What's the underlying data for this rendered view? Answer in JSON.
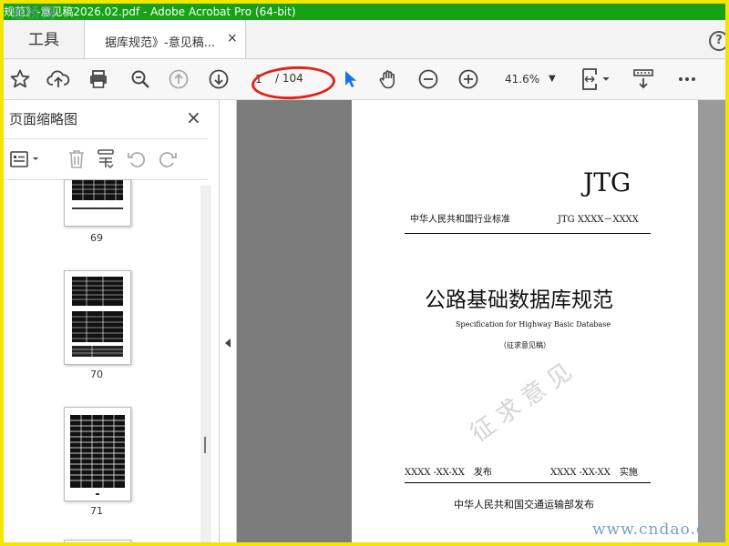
{
  "window": {
    "title": "规范》-意见稿2026.02.pdf - Adobe Acrobat Pro (64-bit)",
    "watermark_logo": "道桥网"
  },
  "tabs": {
    "tools_label": "工具",
    "document_label": "据库规范》-意见稿...",
    "close_glyph": "×",
    "help_glyph": "?"
  },
  "toolbar": {
    "page_current": "1",
    "page_total": "/ 104",
    "zoom_value": "41.6%",
    "zoom_caret": "▼",
    "icons": [
      "bookmark-star-icon",
      "upload-cloud-icon",
      "print-icon",
      "zoom-search-icon",
      "page-up-icon",
      "page-down-icon",
      "select-cursor-icon",
      "hand-tool-icon",
      "zoom-out-icon",
      "zoom-in-icon",
      "fit-page-icon",
      "scroll-mode-icon",
      "more-icon"
    ],
    "accent_color": "#1473e6",
    "annotation_color": "#e2231a"
  },
  "sidebar": {
    "title": "页面缩略图",
    "close_glyph": "×",
    "thumbnails": [
      {
        "page": "69"
      },
      {
        "page": "70"
      },
      {
        "page": "71"
      }
    ]
  },
  "document_page": {
    "code": "JTG",
    "standard_type": "中华人民共和国行业标准",
    "standard_number": "JTG XXXX－XXXX",
    "title_cn": "公路基础数据库规范",
    "title_en": "Specification for Highway Basic Database",
    "draft_label": "（征求意见稿）",
    "stamp_text": "征求意见",
    "publish_date": "XXXX -XX-XX　发布",
    "implement_date": "XXXX -XX-XX　实施",
    "publisher": "中华人民共和国交通运输部发布"
  },
  "site_watermark": "www.cndao.c"
}
